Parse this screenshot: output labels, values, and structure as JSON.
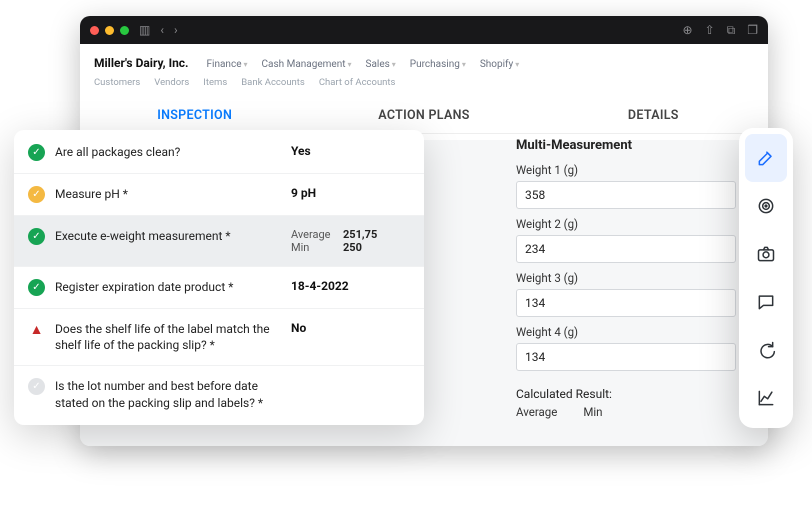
{
  "titlebar": {
    "company": "Miller's Dairy, Inc.",
    "nav": [
      "Finance",
      "Cash Management",
      "Sales",
      "Purchasing",
      "Shopify"
    ],
    "subnav": [
      "Customers",
      "Vendors",
      "Items",
      "Bank Accounts",
      "Chart of Accounts"
    ]
  },
  "outerTabs": {
    "inspection": "INSPECTION",
    "actionPlans": "ACTION PLANS",
    "details": "DETAILS"
  },
  "inspection": {
    "rows": [
      {
        "icon": "check-green",
        "q": "Are all packages clean?",
        "a": "Yes"
      },
      {
        "icon": "check-yellow",
        "q": "Measure pH *",
        "a": "9 pH"
      },
      {
        "icon": "check-green",
        "q": "Execute e-weight measurement *",
        "stats": {
          "avgLabel": "Average",
          "avg": "251,75",
          "minLabel": "Min",
          "min": "250"
        }
      },
      {
        "icon": "check-green",
        "q": "Register expiration date product *",
        "a": "18-4-2022"
      },
      {
        "icon": "warn",
        "q": "Does the shelf life of the label match the shelf life of the packing slip? *",
        "a": "No"
      },
      {
        "icon": "pending",
        "q": "Is the lot number and best before date stated on the packing slip and labels? *",
        "a": ""
      }
    ]
  },
  "detailsPanel": {
    "title": "Multi-Measurement",
    "fields": [
      {
        "label": "Weight 1 (g)",
        "value": "358"
      },
      {
        "label": "Weight 2 (g)",
        "value": "234"
      },
      {
        "label": "Weight 3 (g)",
        "value": "134"
      },
      {
        "label": "Weight 4 (g)",
        "value": "134"
      }
    ],
    "calcTitle": "Calculated Result:",
    "calcCols": {
      "avg": "Average",
      "min": "Min"
    }
  },
  "toolbar": {
    "items": [
      "edit",
      "target",
      "camera",
      "comment",
      "redo",
      "chart"
    ]
  }
}
